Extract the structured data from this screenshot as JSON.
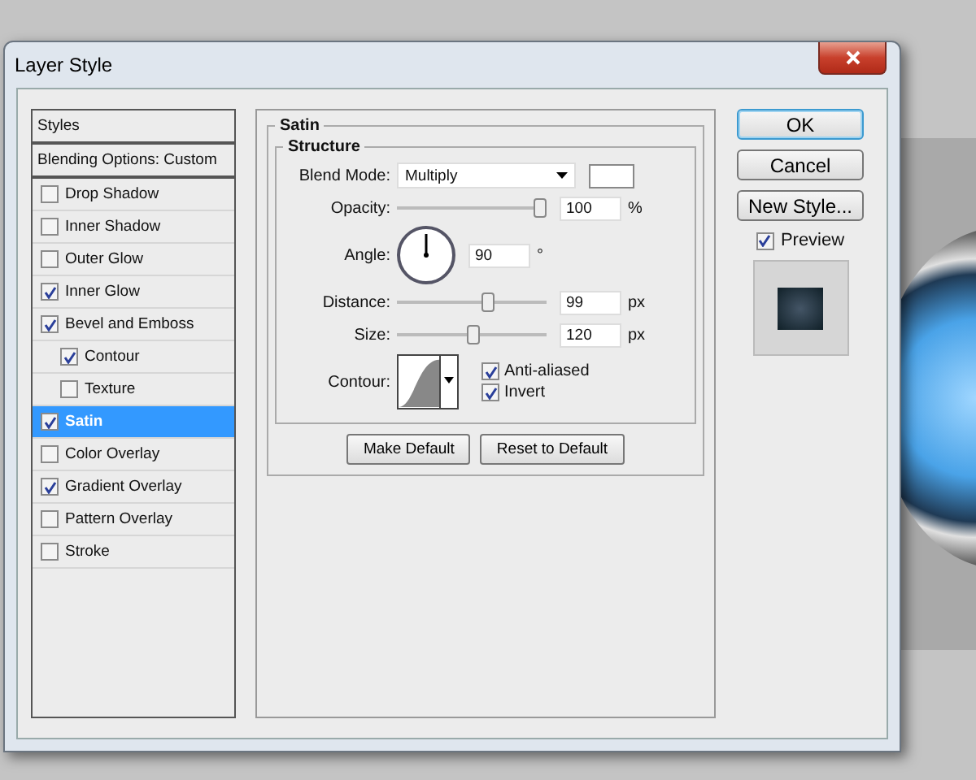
{
  "window": {
    "title": "Layer Style"
  },
  "styles_list": [
    {
      "kind": "header",
      "label": "Styles"
    },
    {
      "kind": "header",
      "label": "Blending Options: Custom"
    },
    {
      "kind": "item",
      "label": "Drop Shadow",
      "checked": false,
      "selected": false
    },
    {
      "kind": "item",
      "label": "Inner Shadow",
      "checked": false,
      "selected": false
    },
    {
      "kind": "item",
      "label": "Outer Glow",
      "checked": false,
      "selected": false
    },
    {
      "kind": "item",
      "label": "Inner Glow",
      "checked": true,
      "selected": false
    },
    {
      "kind": "item",
      "label": "Bevel and Emboss",
      "checked": true,
      "selected": false,
      "children": [
        {
          "kind": "item",
          "label": "Contour",
          "checked": true,
          "selected": false
        },
        {
          "kind": "item",
          "label": "Texture",
          "checked": false,
          "selected": false
        }
      ]
    },
    {
      "kind": "item",
      "label": "Satin",
      "checked": true,
      "selected": true
    },
    {
      "kind": "item",
      "label": "Color Overlay",
      "checked": false,
      "selected": false
    },
    {
      "kind": "item",
      "label": "Gradient Overlay",
      "checked": true,
      "selected": false
    },
    {
      "kind": "item",
      "label": "Pattern Overlay",
      "checked": false,
      "selected": false
    },
    {
      "kind": "item",
      "label": "Stroke",
      "checked": false,
      "selected": false
    }
  ],
  "panel": {
    "title": "Satin",
    "group": "Structure",
    "blend_mode": {
      "label": "Blend Mode:",
      "value": "Multiply",
      "color": "#ffffff"
    },
    "opacity": {
      "label": "Opacity:",
      "level": 1.0,
      "value": "100",
      "unit": "%"
    },
    "angle": {
      "label": "Angle:",
      "value": "90",
      "unit": "°"
    },
    "distance": {
      "label": "Distance:",
      "level": 0.62,
      "value": "99",
      "unit": "px"
    },
    "size": {
      "label": "Size:",
      "level": 0.51,
      "value": "120",
      "unit": "px"
    },
    "contour": {
      "label": "Contour:"
    },
    "anti_aliased": {
      "label": "Anti-aliased",
      "checked": true
    },
    "invert": {
      "label": "Invert",
      "checked": true
    },
    "buttons": [
      "Make Default",
      "Reset to Default"
    ]
  },
  "actions": [
    {
      "label": "OK",
      "default": true
    },
    {
      "label": "Cancel",
      "default": false
    },
    {
      "label": "New Style...",
      "default": false
    }
  ],
  "preview": {
    "label": "Preview",
    "checked": true
  }
}
